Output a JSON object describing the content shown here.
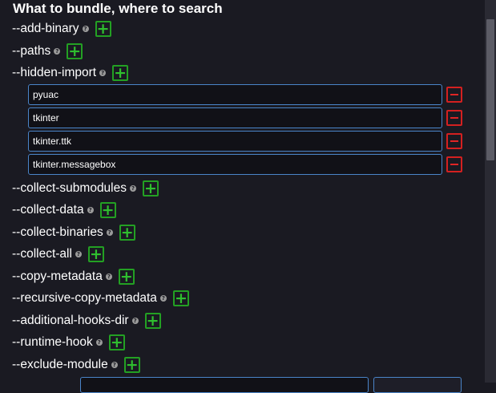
{
  "section": {
    "title": "What to bundle, where to search"
  },
  "help_glyph": "?",
  "add_glyph": "+",
  "options_top": [
    {
      "label": "--add-binary"
    },
    {
      "label": "--paths"
    },
    {
      "label": "--hidden-import"
    }
  ],
  "hidden_imports": [
    {
      "value": "pyuac"
    },
    {
      "value": "tkinter"
    },
    {
      "value": "tkinter.ttk"
    },
    {
      "value": "tkinter.messagebox"
    }
  ],
  "options_bottom": [
    {
      "label": "--collect-submodules"
    },
    {
      "label": "--collect-data"
    },
    {
      "label": "--collect-binaries"
    },
    {
      "label": "--collect-all"
    },
    {
      "label": "--copy-metadata"
    },
    {
      "label": "--recursive-copy-metadata"
    },
    {
      "label": "--additional-hooks-dir"
    },
    {
      "label": "--runtime-hook"
    },
    {
      "label": "--exclude-module"
    }
  ],
  "colors": {
    "background": "#1a1a22",
    "add_green": "#23a023",
    "remove_red": "#d42020",
    "input_border": "#4a84c8"
  }
}
